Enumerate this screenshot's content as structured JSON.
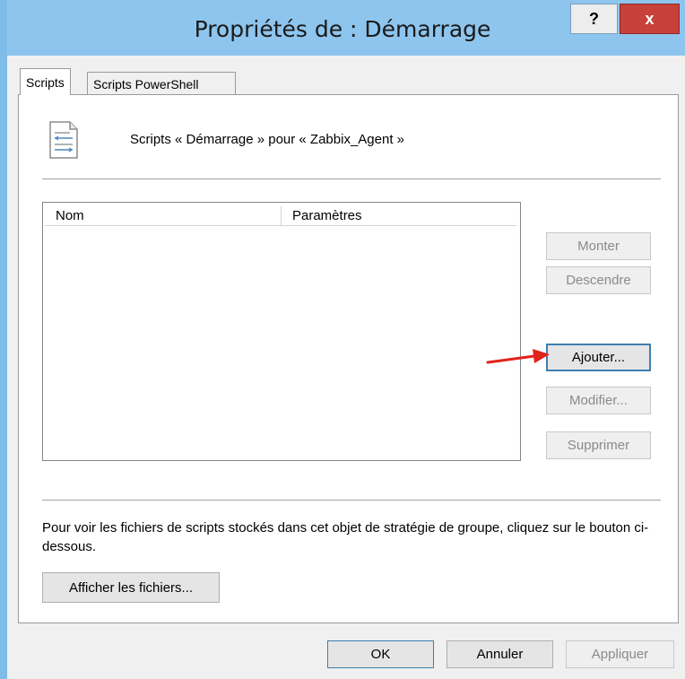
{
  "window": {
    "title": "Propriétés de : Démarrage",
    "help_label": "?",
    "close_label": "x"
  },
  "tabs": [
    {
      "label": "Scripts",
      "active": true
    },
    {
      "label": "Scripts PowerShell",
      "active": false
    }
  ],
  "heading": "Scripts « Démarrage » pour « Zabbix_Agent »",
  "list": {
    "columns": [
      "Nom",
      "Paramètres"
    ],
    "rows": []
  },
  "side_buttons": {
    "up": "Monter",
    "down": "Descendre",
    "add": "Ajouter...",
    "edit": "Modifier...",
    "remove": "Supprimer"
  },
  "info_text": "Pour voir les fichiers de scripts stockés dans cet objet de stratégie de groupe, cliquez sur le bouton ci-dessous.",
  "show_files_button": "Afficher les fichiers...",
  "footer": {
    "ok": "OK",
    "cancel": "Annuler",
    "apply": "Appliquer"
  },
  "colors": {
    "titlebar": "#8ec5ee",
    "close": "#c8403a",
    "arrow": "#e0231b",
    "focus_border": "#3c7fb1"
  },
  "icons": [
    "script-document-icon",
    "help-icon",
    "close-icon",
    "red-arrow-annotation"
  ]
}
